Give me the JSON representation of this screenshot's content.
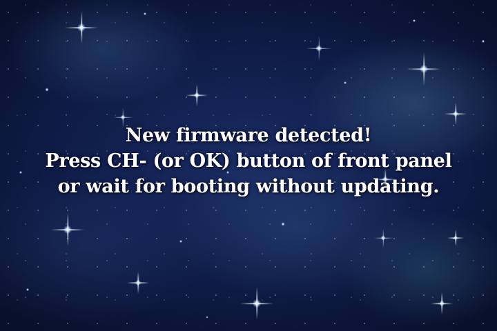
{
  "message": {
    "line1": "New firmware detected!",
    "line2": "Press CH- (or OK) button of front panel",
    "line3": "or wait for booting without updating."
  },
  "colors": {
    "background": "#0f1c48",
    "text": "#ffffff"
  }
}
